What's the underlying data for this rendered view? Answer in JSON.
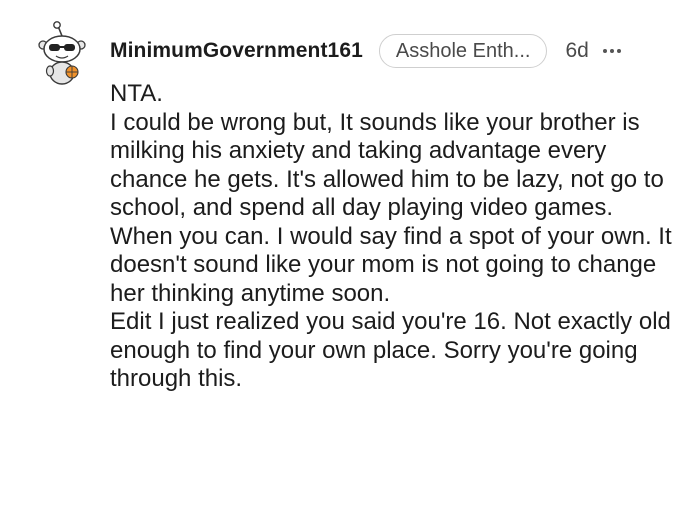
{
  "comment": {
    "author": "MinimumGovernment161",
    "flair": "Asshole Enth...",
    "time_ago": "6d",
    "more_icon": "more-horizontal-icon",
    "avatar_icon": "snoo-sunglasses-avatar",
    "paragraphs": [
      "NTA.",
      "I could be wrong but, It sounds like your brother is milking his anxiety and taking advantage every chance he gets. It's allowed him to be lazy, not go to school, and spend all day playing video games. When you can. I would say find a spot of your own. It doesn't sound like your mom is not going to change her thinking anytime soon.",
      "Edit I just realized you said you're 16. Not exactly old enough to find your own place. Sorry you're going through this."
    ]
  }
}
